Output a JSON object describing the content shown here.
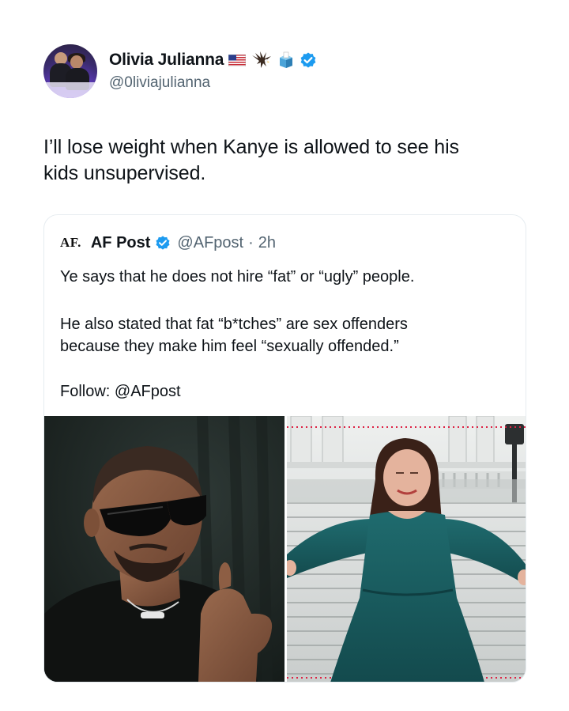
{
  "tweet": {
    "display_name": "Olivia Julianna",
    "handle": "@0liviajulianna",
    "verified": true,
    "name_emojis": [
      "us-flag",
      "eagle",
      "ballot-box"
    ],
    "text_line1": "I’ll lose weight when Kanye is allowed to see his",
    "text_line2": "kids unsupervised."
  },
  "quote": {
    "logo_text": "AF.",
    "name": "AF Post",
    "handle": "@AFpost",
    "separator": "·",
    "time": "2h",
    "verified": true,
    "line1": "Ye says that he does not hire “fat” or “ugly” people.",
    "line2": "He also stated that fat “b*tches” are sex offenders",
    "line3": "because they make him feel “sexually offended.”",
    "line4": "Follow: @AFpost"
  },
  "images": [
    {
      "name": "man-in-sunglasses-photo"
    },
    {
      "name": "woman-on-capitol-steps-photo"
    }
  ],
  "colors": {
    "verified_blue": "#1d9bf0",
    "text_primary": "#0f1419",
    "text_secondary": "#536471",
    "border": "#e6ecf0"
  }
}
